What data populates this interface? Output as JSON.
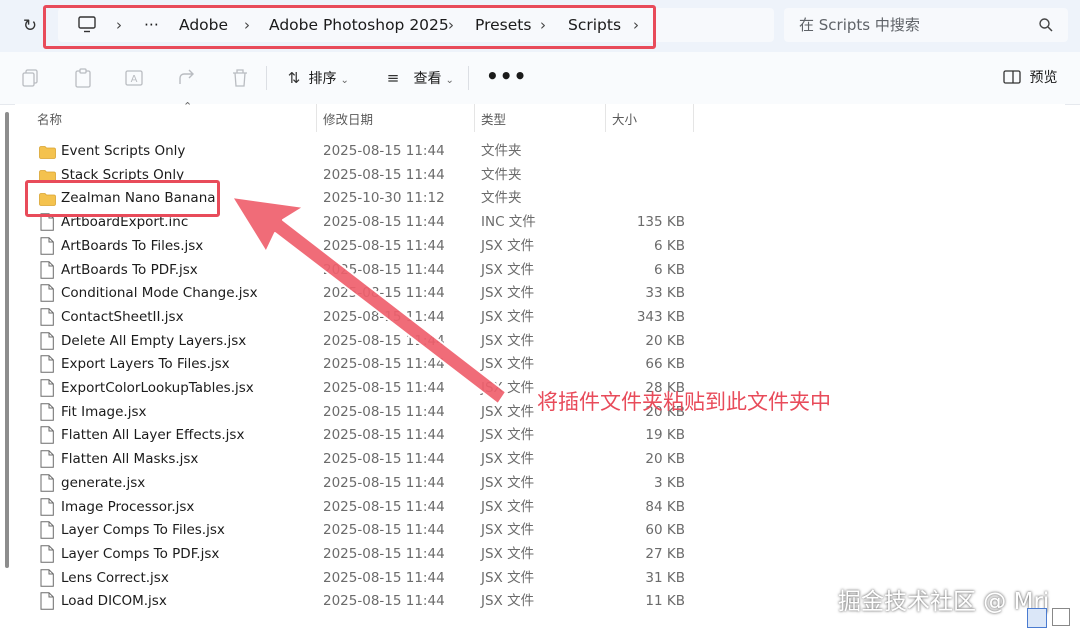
{
  "breadcrumb": {
    "ellipsis": "···",
    "items": [
      "Adobe",
      "Adobe Photoshop 2025",
      "Presets",
      "Scripts"
    ]
  },
  "search": {
    "placeholder": "在 Scripts 中搜索"
  },
  "toolbar": {
    "sort_label": "排序",
    "view_label": "查看",
    "more_label": "•••",
    "preview_label": "预览"
  },
  "columns": {
    "name": "名称",
    "date": "修改日期",
    "type": "类型",
    "size": "大小"
  },
  "files": [
    {
      "icon": "folder-icon",
      "name": "Event Scripts Only",
      "date": "2025-08-15 11:44",
      "type": "文件夹",
      "size": ""
    },
    {
      "icon": "folder-icon",
      "name": "Stack Scripts Only",
      "date": "2025-08-15 11:44",
      "type": "文件夹",
      "size": ""
    },
    {
      "icon": "folder-icon",
      "name": "Zealman Nano Banana",
      "date": "2025-10-30 11:12",
      "type": "文件夹",
      "size": ""
    },
    {
      "icon": "file-icon",
      "name": "ArtboardExport.inc",
      "date": "2025-08-15 11:44",
      "type": "INC 文件",
      "size": "135 KB"
    },
    {
      "icon": "file-icon",
      "name": "ArtBoards To Files.jsx",
      "date": "2025-08-15 11:44",
      "type": "JSX 文件",
      "size": "6 KB"
    },
    {
      "icon": "file-icon",
      "name": "ArtBoards To PDF.jsx",
      "date": "2025-08-15 11:44",
      "type": "JSX 文件",
      "size": "6 KB"
    },
    {
      "icon": "file-icon",
      "name": "Conditional Mode Change.jsx",
      "date": "2025-08-15 11:44",
      "type": "JSX 文件",
      "size": "33 KB"
    },
    {
      "icon": "file-icon",
      "name": "ContactSheetII.jsx",
      "date": "2025-08-15 11:44",
      "type": "JSX 文件",
      "size": "343 KB"
    },
    {
      "icon": "file-icon",
      "name": "Delete All Empty Layers.jsx",
      "date": "2025-08-15 11:44",
      "type": "JSX 文件",
      "size": "20 KB"
    },
    {
      "icon": "file-icon",
      "name": "Export Layers To Files.jsx",
      "date": "2025-08-15 11:44",
      "type": "JSX 文件",
      "size": "66 KB"
    },
    {
      "icon": "file-icon",
      "name": "ExportColorLookupTables.jsx",
      "date": "2025-08-15 11:44",
      "type": "JSX 文件",
      "size": "28 KB"
    },
    {
      "icon": "file-icon",
      "name": "Fit Image.jsx",
      "date": "2025-08-15 11:44",
      "type": "JSX 文件",
      "size": "20 KB"
    },
    {
      "icon": "file-icon",
      "name": "Flatten All Layer Effects.jsx",
      "date": "2025-08-15 11:44",
      "type": "JSX 文件",
      "size": "19 KB"
    },
    {
      "icon": "file-icon",
      "name": "Flatten All Masks.jsx",
      "date": "2025-08-15 11:44",
      "type": "JSX 文件",
      "size": "20 KB"
    },
    {
      "icon": "file-icon",
      "name": "generate.jsx",
      "date": "2025-08-15 11:44",
      "type": "JSX 文件",
      "size": "3 KB"
    },
    {
      "icon": "file-icon",
      "name": "Image Processor.jsx",
      "date": "2025-08-15 11:44",
      "type": "JSX 文件",
      "size": "84 KB"
    },
    {
      "icon": "file-icon",
      "name": "Layer Comps To Files.jsx",
      "date": "2025-08-15 11:44",
      "type": "JSX 文件",
      "size": "60 KB"
    },
    {
      "icon": "file-icon",
      "name": "Layer Comps To PDF.jsx",
      "date": "2025-08-15 11:44",
      "type": "JSX 文件",
      "size": "27 KB"
    },
    {
      "icon": "file-icon",
      "name": "Lens Correct.jsx",
      "date": "2025-08-15 11:44",
      "type": "JSX 文件",
      "size": "31 KB"
    },
    {
      "icon": "file-icon",
      "name": "Load DICOM.jsx",
      "date": "2025-08-15 11:44",
      "type": "JSX 文件",
      "size": "11 KB"
    }
  ],
  "annotation": {
    "text": "将插件文件夹粘贴到此文件夹中",
    "color": "#e84b5a"
  },
  "watermark": "掘金技术社区 @ Mrj",
  "colors": {
    "highlight": "#e84b5a",
    "folder": "#f4c24e",
    "topbar": "#eef3fa"
  }
}
